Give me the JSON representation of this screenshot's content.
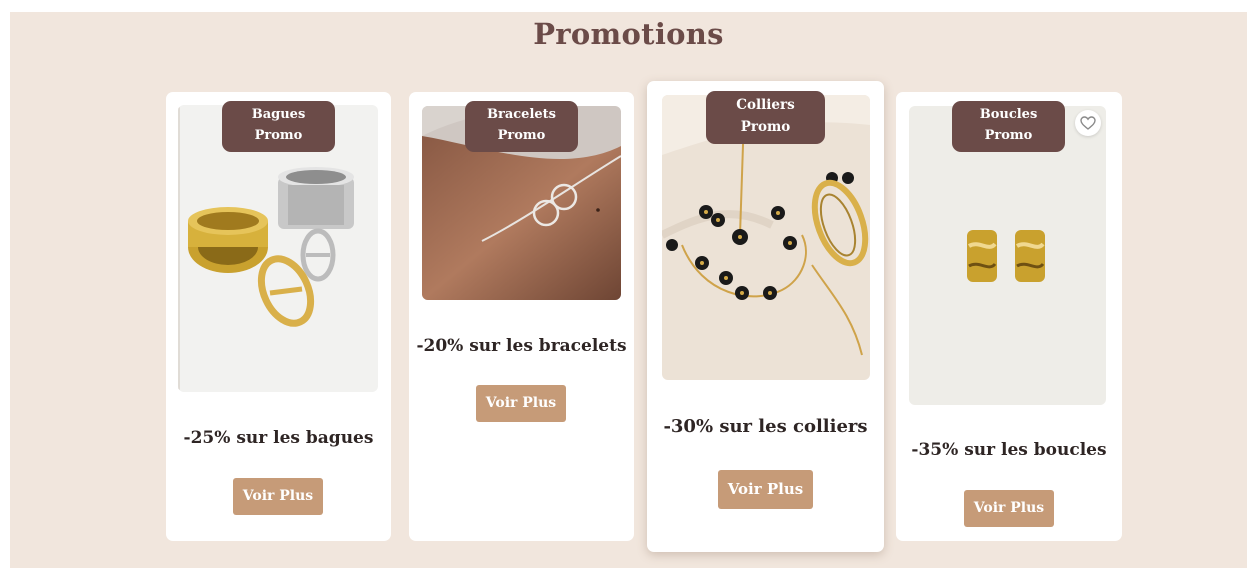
{
  "page": {
    "title": "Promotions"
  },
  "colors": {
    "background": "#f1e6dd",
    "badge": "#6b4b48",
    "button": "#c69b78",
    "title": "#6b4b48"
  },
  "cards": [
    {
      "badge_line1": "Bagues",
      "badge_line2": "Promo",
      "text": "-25% sur les bagues",
      "button": "Voir Plus",
      "image": "rings-photo"
    },
    {
      "badge_line1": "Bracelets",
      "badge_line2": "Promo",
      "text": "-20% sur les bracelets",
      "button": "Voir Plus",
      "image": "bracelet-photo"
    },
    {
      "badge_line1": "Colliers",
      "badge_line2": "Promo",
      "text": "-30% sur les colliers",
      "button": "Voir Plus",
      "image": "necklace-photo"
    },
    {
      "badge_line1": "Boucles",
      "badge_line2": "Promo",
      "text": "-35% sur les boucles",
      "button": "Voir Plus",
      "image": "earrings-photo",
      "favorite_icon": "heart-icon"
    }
  ]
}
